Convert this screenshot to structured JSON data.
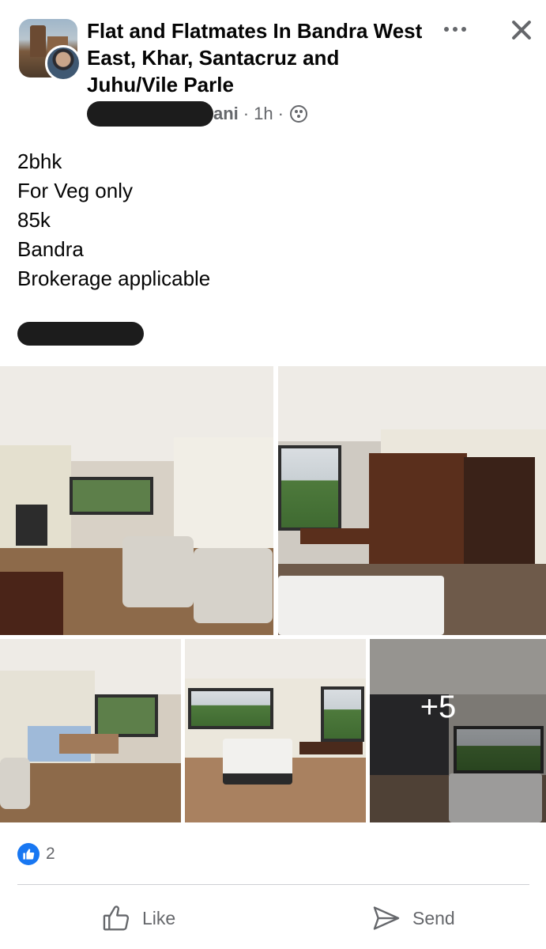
{
  "header": {
    "group_title": "Flat and Flatmates In Bandra West East, Khar, Santacruz and Juhu/Vile Parle",
    "author_visible_suffix": "ani",
    "separator": "·",
    "timestamp": "1h",
    "privacy_icon": "globe-icon",
    "more_icon": "more-options-icon",
    "close_icon": "close-icon"
  },
  "post": {
    "lines": [
      "2bhk",
      "For Veg only",
      "85k",
      "Bandra",
      "Brokerage applicable"
    ]
  },
  "photos": {
    "more_count": "+5"
  },
  "reactions": {
    "icon": "like-reaction-icon",
    "count": "2"
  },
  "actions": {
    "like_label": "Like",
    "send_label": "Send"
  },
  "colors": {
    "text_primary": "#050505",
    "text_secondary": "#65676b",
    "reaction_blue": "#1877f2",
    "divider": "#ced0d4"
  }
}
